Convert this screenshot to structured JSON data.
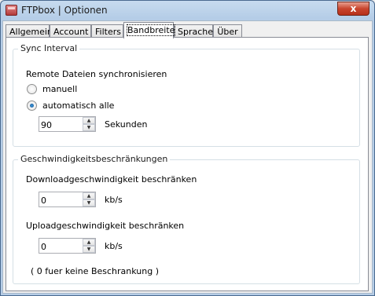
{
  "window": {
    "title": "FTPbox | Optionen",
    "close_symbol": "x"
  },
  "tabs": [
    {
      "label": "Allgemein"
    },
    {
      "label": "Account"
    },
    {
      "label": "Filters"
    },
    {
      "label": "Bandbreite",
      "active": true
    },
    {
      "label": "Sprache"
    },
    {
      "label": "Über"
    }
  ],
  "sync": {
    "legend": "Sync Interval",
    "heading": "Remote Dateien synchronisieren",
    "option_manual": "manuell",
    "option_auto": "automatisch alle",
    "selected": "automatisch alle",
    "interval_value": "90",
    "interval_unit": "Sekunden"
  },
  "speed": {
    "legend": "Geschwindigkeitsbeschränkungen",
    "download_label": "Downloadgeschwindigkeit beschränken",
    "download_value": "0",
    "download_unit": "kb/s",
    "upload_label": "Uploadgeschwindigkeit beschränken",
    "upload_value": "0",
    "upload_unit": "kb/s",
    "note": "( 0 fuer keine Beschrankung )"
  }
}
